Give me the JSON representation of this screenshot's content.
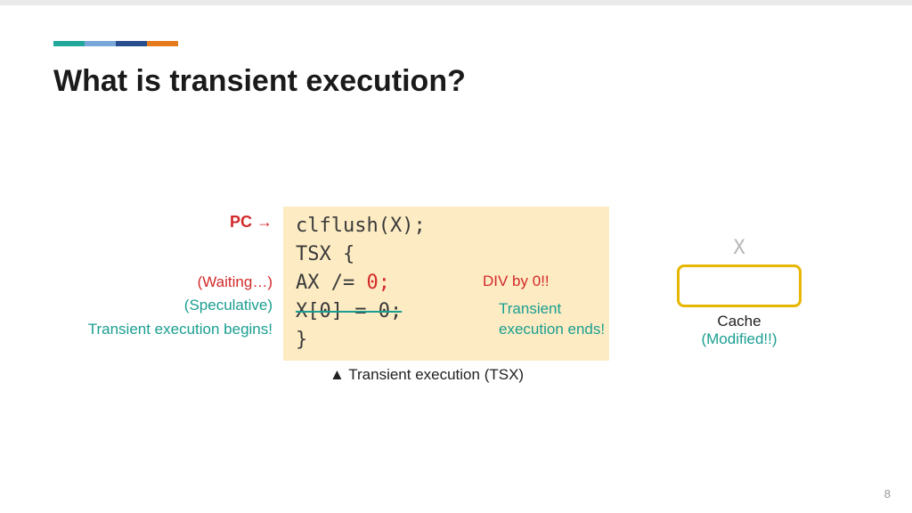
{
  "title": "What is transient execution?",
  "left": {
    "pc": "PC →",
    "waiting": "(Waiting…)",
    "speculative": "(Speculative)",
    "begins": "Transient execution begins!"
  },
  "code": {
    "l1": "clflush(X);",
    "l2": "TSX {",
    "l3a": "    AX /= ",
    "l3b": "0;",
    "l4": "    X[0] = 0;",
    "l5": "}"
  },
  "annos": {
    "div0": "DIV by 0!!",
    "trans_end1": "Transient",
    "trans_end2": "execution ends!"
  },
  "caption": "▲ Transient execution (TSX)",
  "cache": {
    "x": "X",
    "label": "Cache",
    "modified": "(Modified!!)"
  },
  "page": "8"
}
